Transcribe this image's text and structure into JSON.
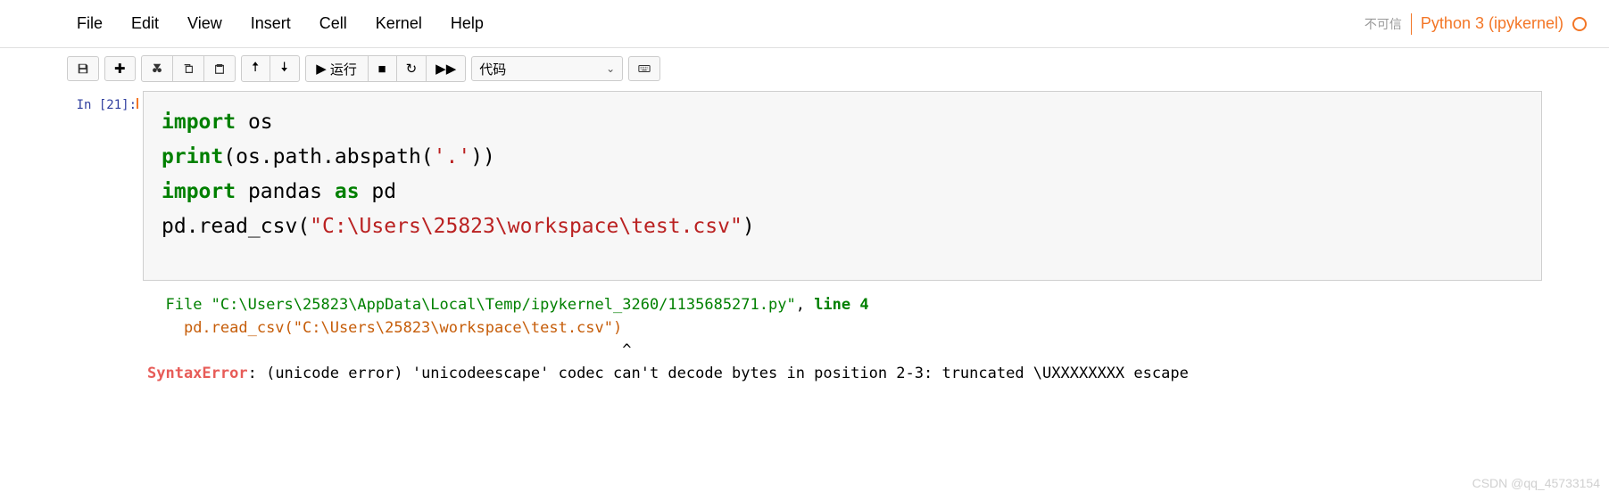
{
  "menu": {
    "file": "File",
    "edit": "Edit",
    "view": "View",
    "insert": "Insert",
    "cell": "Cell",
    "kernel": "Kernel",
    "help": "Help"
  },
  "header": {
    "trust": "不可信",
    "kernel": "Python 3 (ipykernel)"
  },
  "toolbar": {
    "run_label": "运行",
    "cell_type": "代码"
  },
  "cell": {
    "prompt": "In [21]:",
    "code": {
      "l1_kw": "import",
      "l1_mod": " os",
      "l2_fn": "print",
      "l2_p1": "(os.path.abspath(",
      "l2_str": "'.'",
      "l2_p2": "))",
      "l3_kw": "import",
      "l3_mod": " pandas ",
      "l3_as": "as",
      "l3_alias": " pd",
      "l4_call": "pd.read_csv(",
      "l4_str": "\"C:\\Users\\25823\\workspace\\test.csv\"",
      "l4_close": ")"
    }
  },
  "output": {
    "trace_file_kw": "  File ",
    "trace_file_path": "\"C:\\Users\\25823\\AppData\\Local\\Temp/ipykernel_3260/1135685271.py\"",
    "trace_comma": ", ",
    "trace_line_kw": "line ",
    "trace_line_no": "4",
    "trace_code": "    pd.read_csv(\"C:\\Users\\25823\\workspace\\test.csv\")",
    "trace_caret": "                                                    ^",
    "err_type": "SyntaxError",
    "err_colon": ": ",
    "err_msg": "(unicode error) 'unicodeescape' codec can't decode bytes in position 2-3: truncated \\UXXXXXXXX escape"
  },
  "watermark": "CSDN @qq_45733154"
}
